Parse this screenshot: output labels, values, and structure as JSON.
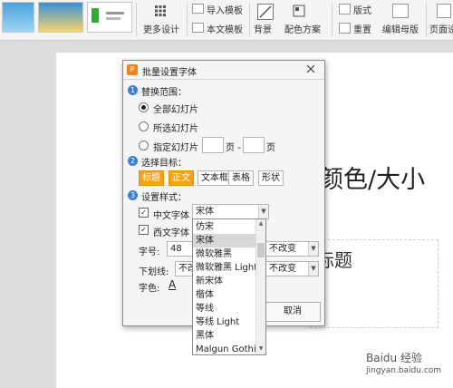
{
  "ribbon": {
    "more_design": "更多设计",
    "import_template": "导入模板",
    "this_template": "本文模板",
    "background": "背景",
    "color_scheme": "配色方案",
    "layout": "版式",
    "reset": "重置",
    "edit_master": "编辑母版",
    "page_setup": "页面设"
  },
  "slide": {
    "title_fragment": "颜色/大小",
    "subtitle_fragment": "标题"
  },
  "dialog": {
    "title": "批量设置字体",
    "section1": "替换范围：",
    "section1_num": "1",
    "opt_all": "全部幻灯片",
    "opt_selected": "所选幻灯片",
    "opt_specified": "指定幻灯片",
    "page_sep": "页 -",
    "page_end": "页",
    "section2": "选择目标：",
    "section2_num": "2",
    "targets": [
      "标题",
      "正文",
      "文本框",
      "表格",
      "形状"
    ],
    "section3": "设置样式：",
    "section3_num": "3",
    "cn_font_label": "中文字体",
    "cn_font_value": "宋体",
    "west_font_label": "西文字体",
    "size_label": "字号:",
    "size_value": "48",
    "underline_label": "下划线:",
    "underline_value": "不改",
    "color_label": "字色:",
    "color_letter": "A",
    "no_change_1": "不改变",
    "no_change_2": "不改变",
    "cancel": "取消"
  },
  "dropdown": {
    "items": [
      "仿宋",
      "宋体",
      "微软雅黑",
      "微软雅黑 Light",
      "新宋体",
      "楷体",
      "等线",
      "等线 Light",
      "黑体",
      "Malgun Gothic"
    ],
    "highlighted": "宋体"
  },
  "watermark": {
    "line1": "Baidu 经验",
    "line2": "jingyan.baidu.com"
  },
  "colors": {
    "accent_orange": "#f3a21b",
    "section_blue": "#3d7fd6"
  }
}
